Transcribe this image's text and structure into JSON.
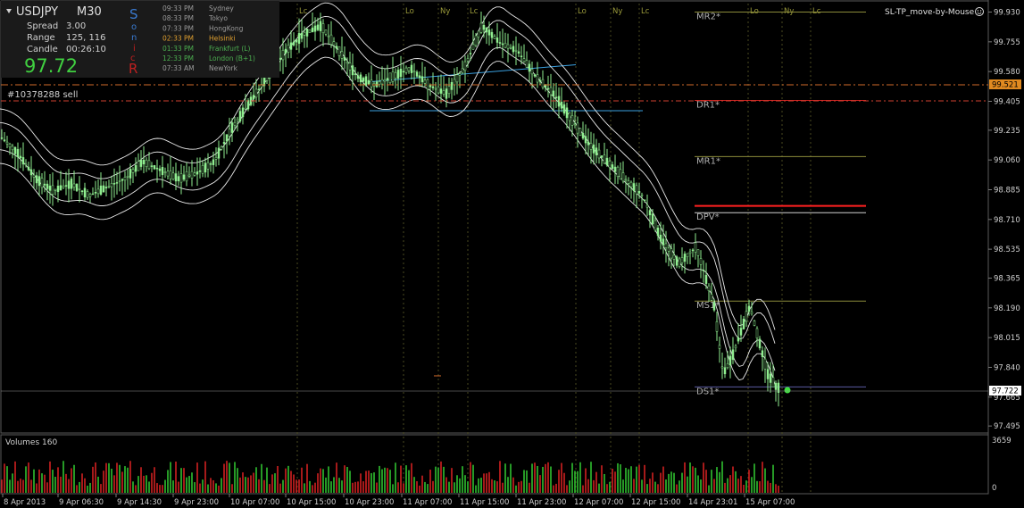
{
  "window": {
    "symbol": "USDJPY",
    "timeframe": "M30",
    "ea_label": "SL-TP_move-by-Mouse",
    "order_label": "#10378288 sell"
  },
  "info_panel": {
    "spread_label": "Spread",
    "spread_value": "3.00",
    "range_label": "Range",
    "range_value": "125, 116",
    "candle_label": "Candle",
    "candle_value": "00:26:10",
    "big_price": "97.72",
    "sonic_letters": [
      "S",
      "o",
      "n",
      "i",
      "c",
      "R"
    ]
  },
  "timezones": [
    {
      "time": "09:33 PM",
      "city": "Sydney",
      "color": "#9a9a9a"
    },
    {
      "time": "08:33 PM",
      "city": "Tokyo",
      "color": "#9a9a9a"
    },
    {
      "time": "07:33 PM",
      "city": "HongKong",
      "color": "#9a9a9a"
    },
    {
      "time": "02:33 PM",
      "city": "Helsinki",
      "color": "#e0a030"
    },
    {
      "time": "01:33 PM",
      "city": "Frankfurt  (L)",
      "color": "#4caf50"
    },
    {
      "time": "12:33 PM",
      "city": "London  (B+1)",
      "color": "#4caf50"
    },
    {
      "time": "07:33 AM",
      "city": "NewYork",
      "color": "#9a9a9a"
    }
  ],
  "price_axis": {
    "ticks": [
      "99.930",
      "99.755",
      "99.580",
      "99.405",
      "99.235",
      "99.060",
      "98.885",
      "98.710",
      "98.535",
      "98.365",
      "98.190",
      "98.015",
      "97.840",
      "97.665",
      "97.495"
    ],
    "current_price": "97.722",
    "order_price": "99.521"
  },
  "time_axis": {
    "ticks": [
      "8 Apr 2013",
      "9 Apr 06:30",
      "9 Apr 14:30",
      "9 Apr 23:00",
      "10 Apr 07:00",
      "10 Apr 15:00",
      "10 Apr 23:00",
      "11 Apr 07:00",
      "11 Apr 15:00",
      "11 Apr 23:00",
      "12 Apr 07:00",
      "12 Apr 15:00",
      "14 Apr 23:01",
      "15 Apr 07:00"
    ]
  },
  "levels": [
    {
      "label": "MR2*",
      "price": 99.93,
      "color": "#8a8a3a"
    },
    {
      "label": "DR1*",
      "price": 99.41,
      "color": "#cc2020"
    },
    {
      "label": "MR1*",
      "price": 99.08,
      "color": "#8a8a3a"
    },
    {
      "label": "DPV*",
      "price": 98.75,
      "color": "#d0d0d0"
    },
    {
      "label": "MS1*",
      "price": 98.23,
      "color": "#8a8a3a"
    },
    {
      "label": "DS1*",
      "price": 97.725,
      "color": "#5a5aa0"
    }
  ],
  "session_markers": [
    "Lc",
    "Lo",
    "Ny",
    "Lc",
    "Lo",
    "Ny",
    "Lc",
    "Lo",
    "Ny",
    "Lc"
  ],
  "volumes": {
    "title": "Volumes 160",
    "max_label": "3659",
    "zero_label": "0"
  },
  "chart_data": {
    "type": "candlestick",
    "symbol": "USDJPY",
    "timeframe": "M30",
    "ylim": [
      97.48,
      99.98
    ],
    "close_path": [
      [
        0,
        99.2
      ],
      [
        20,
        99.1
      ],
      [
        40,
        98.95
      ],
      [
        60,
        98.88
      ],
      [
        80,
        98.92
      ],
      [
        100,
        98.85
      ],
      [
        120,
        98.9
      ],
      [
        140,
        98.95
      ],
      [
        160,
        99.05
      ],
      [
        180,
        99.0
      ],
      [
        200,
        98.95
      ],
      [
        220,
        98.98
      ],
      [
        240,
        99.05
      ],
      [
        260,
        99.25
      ],
      [
        280,
        99.4
      ],
      [
        300,
        99.55
      ],
      [
        320,
        99.7
      ],
      [
        340,
        99.8
      ],
      [
        360,
        99.85
      ],
      [
        380,
        99.7
      ],
      [
        400,
        99.55
      ],
      [
        420,
        99.5
      ],
      [
        440,
        99.55
      ],
      [
        460,
        99.6
      ],
      [
        480,
        99.5
      ],
      [
        500,
        99.45
      ],
      [
        520,
        99.6
      ],
      [
        540,
        99.85
      ],
      [
        560,
        99.75
      ],
      [
        580,
        99.7
      ],
      [
        600,
        99.55
      ],
      [
        620,
        99.45
      ],
      [
        640,
        99.3
      ],
      [
        660,
        99.15
      ],
      [
        680,
        99.05
      ],
      [
        700,
        98.95
      ],
      [
        720,
        98.85
      ],
      [
        740,
        98.6
      ],
      [
        760,
        98.45
      ],
      [
        780,
        98.55
      ],
      [
        800,
        98.2
      ],
      [
        810,
        97.8
      ],
      [
        820,
        97.9
      ],
      [
        830,
        98.05
      ],
      [
        840,
        98.2
      ],
      [
        850,
        98.0
      ],
      [
        860,
        97.8
      ],
      [
        870,
        97.72
      ]
    ],
    "current_price": 97.722,
    "order_price": 99.521
  }
}
